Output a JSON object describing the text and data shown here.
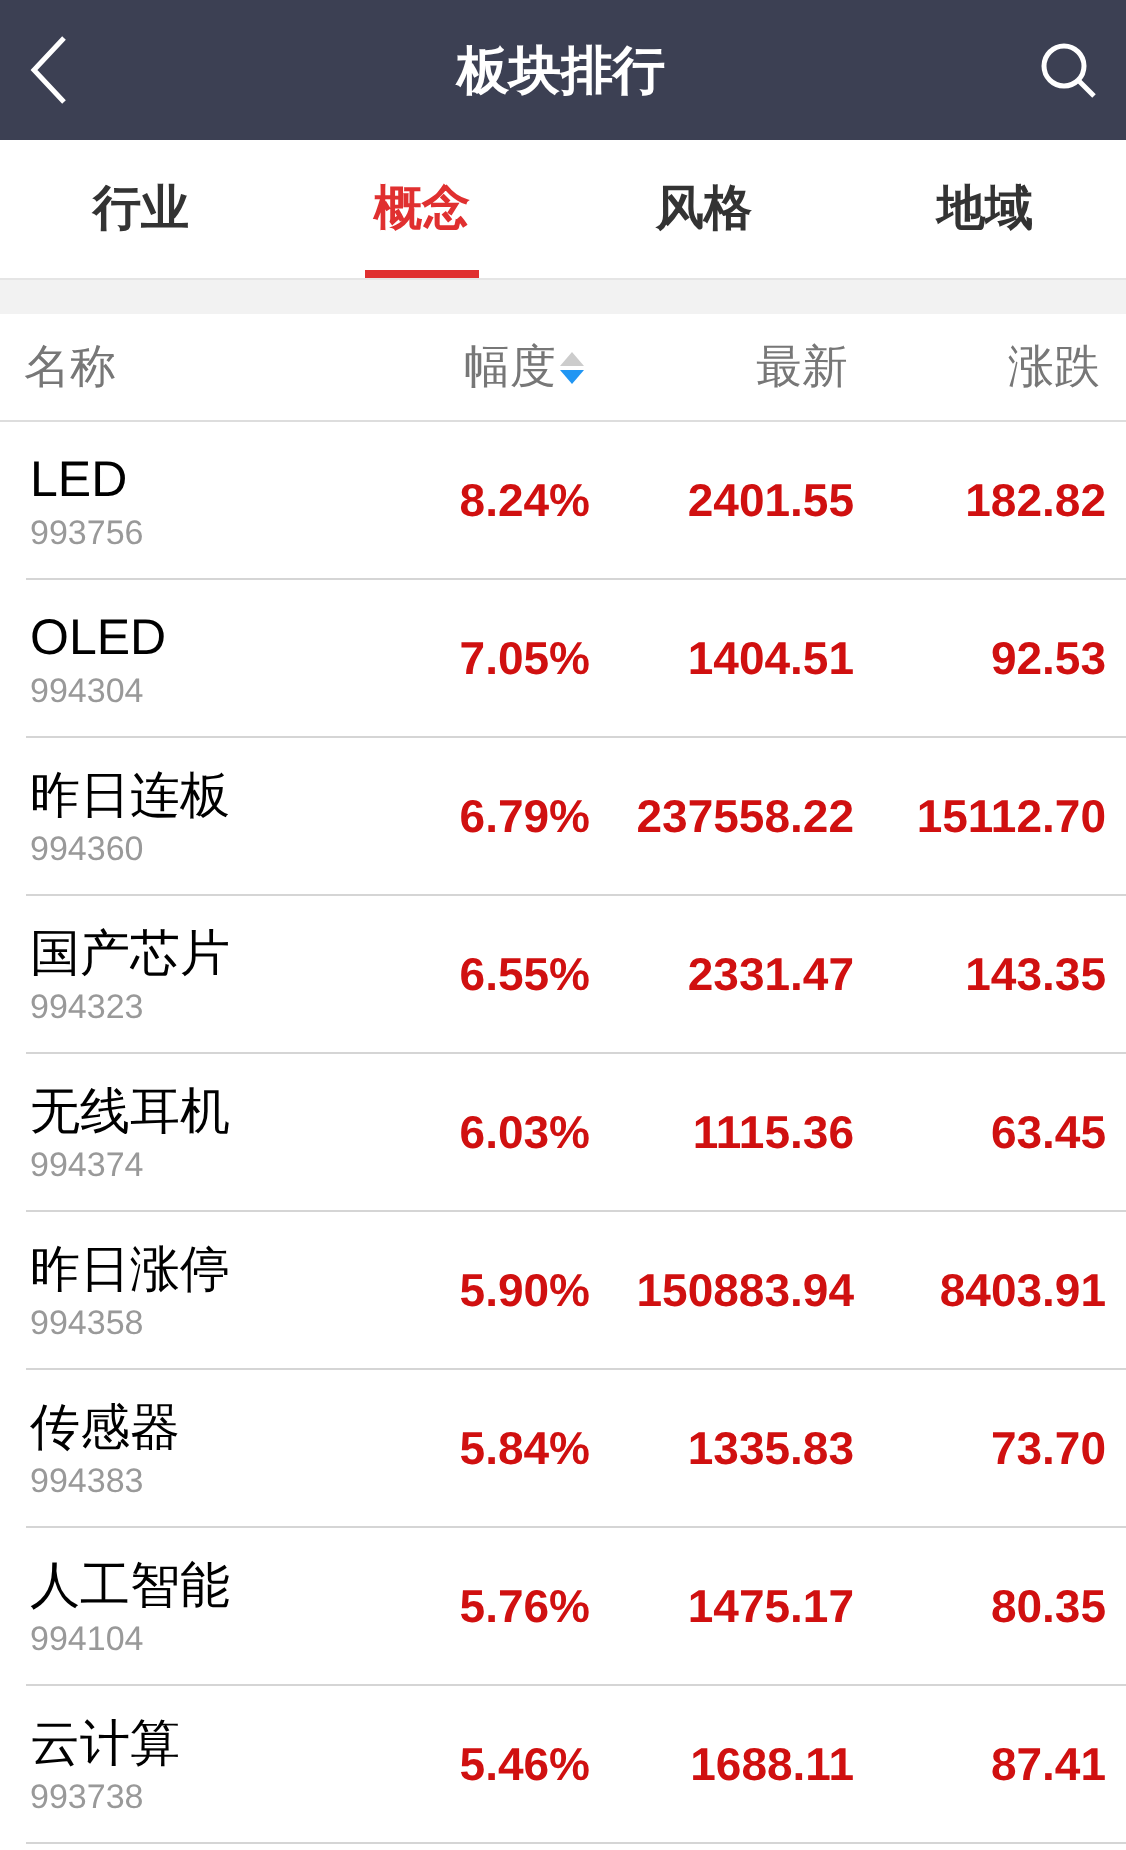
{
  "title": "板块排行",
  "tabs": [
    {
      "label": "行业",
      "selected": false
    },
    {
      "label": "概念",
      "selected": true
    },
    {
      "label": "风格",
      "selected": false
    },
    {
      "label": "地域",
      "selected": false
    }
  ],
  "columns": [
    {
      "label": "名称",
      "sorted": false
    },
    {
      "label": "幅度",
      "sorted": true
    },
    {
      "label": "最新",
      "sorted": false
    },
    {
      "label": "涨跌",
      "sorted": false
    }
  ],
  "rows": [
    {
      "name": "LED",
      "code": "993756",
      "change_pct": "8.24%",
      "latest": "2401.55",
      "change": "182.82"
    },
    {
      "name": "OLED",
      "code": "994304",
      "change_pct": "7.05%",
      "latest": "1404.51",
      "change": "92.53"
    },
    {
      "name": "昨日连板",
      "code": "994360",
      "change_pct": "6.79%",
      "latest": "237558.22",
      "change": "15112.70"
    },
    {
      "name": "国产芯片",
      "code": "994323",
      "change_pct": "6.55%",
      "latest": "2331.47",
      "change": "143.35"
    },
    {
      "name": "无线耳机",
      "code": "994374",
      "change_pct": "6.03%",
      "latest": "1115.36",
      "change": "63.45"
    },
    {
      "name": "昨日涨停",
      "code": "994358",
      "change_pct": "5.90%",
      "latest": "150883.94",
      "change": "8403.91"
    },
    {
      "name": "传感器",
      "code": "994383",
      "change_pct": "5.84%",
      "latest": "1335.83",
      "change": "73.70"
    },
    {
      "name": "人工智能",
      "code": "994104",
      "change_pct": "5.76%",
      "latest": "1475.17",
      "change": "80.35"
    },
    {
      "name": "云计算",
      "code": "993738",
      "change_pct": "5.46%",
      "latest": "1688.11",
      "change": "87.41"
    }
  ]
}
